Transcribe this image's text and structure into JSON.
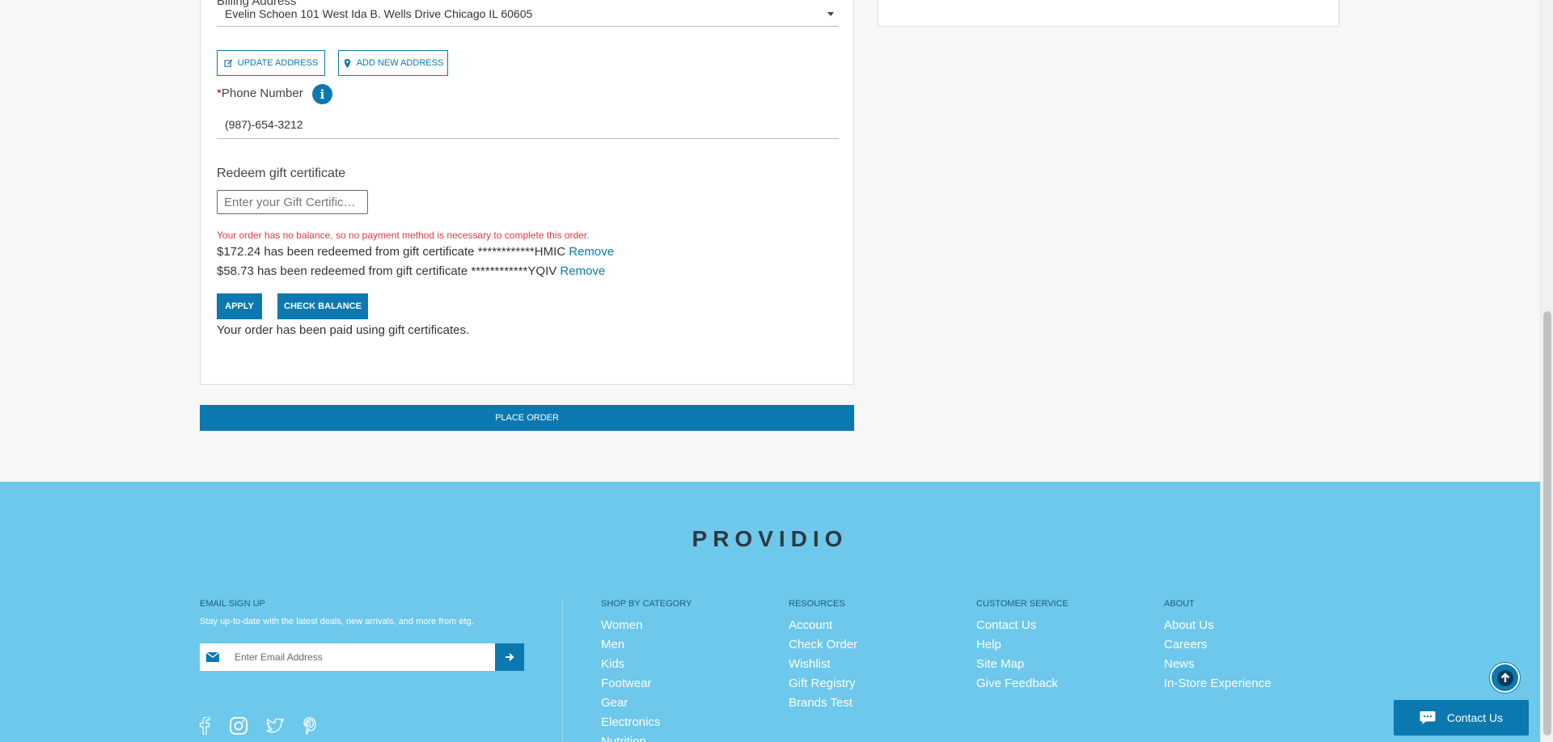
{
  "billing": {
    "label": "Billing Address",
    "selected_address": "Evelin Schoen 101 West Ida B. Wells Drive Chicago IL 60605",
    "update_label": "UPDATE ADDRESS",
    "add_label": "ADD NEW ADDRESS"
  },
  "phone": {
    "label": "Phone Number",
    "required_mark": "*",
    "value": "(987)-654-3212"
  },
  "gift": {
    "label": "Redeem gift certificate",
    "placeholder": "Enter your Gift Certificate Code",
    "no_balance_msg": "Your order has no balance, so no payment method is necessary to complete this order.",
    "redeemed": [
      {
        "text": "$172.24 has been redeemed from gift certificate ************HMIC",
        "action": "Remove"
      },
      {
        "text": "$58.73 has been redeemed from gift certificate ************YQIV",
        "action": "Remove"
      }
    ],
    "apply_label": "APPLY",
    "check_balance_label": "CHECK BALANCE",
    "paid_msg": "Your order has been paid using gift certificates."
  },
  "place_order_label": "PLACE ORDER",
  "footer": {
    "brand": "PROVIDIO",
    "email_signup": {
      "heading": "EMAIL SIGN UP",
      "text": "Stay up-to-date with the latest deals, new arrivals, and more from etg.",
      "placeholder": "Enter Email Address"
    },
    "columns": [
      {
        "heading": "SHOP BY CATEGORY",
        "links": [
          "Women",
          "Men",
          "Kids",
          "Footwear",
          "Gear",
          "Electronics",
          "Nutrition"
        ]
      },
      {
        "heading": "RESOURCES",
        "links": [
          "Account",
          "Check Order",
          "Wishlist",
          "Gift Registry",
          "Brands Test"
        ]
      },
      {
        "heading": "CUSTOMER SERVICE",
        "links": [
          "Contact Us",
          "Help",
          "Site Map",
          "Give Feedback"
        ]
      },
      {
        "heading": "ABOUT",
        "links": [
          "About Us",
          "Careers",
          "News",
          "In-Store Experience"
        ]
      }
    ],
    "social_icons": [
      "facebook-icon",
      "instagram-icon",
      "twitter-icon",
      "pinterest-icon"
    ]
  },
  "contact_us_label": "Contact Us",
  "colors": {
    "primary": "#0b79b0",
    "footer_bg": "#6dc8eb",
    "error": "#e0393e"
  }
}
